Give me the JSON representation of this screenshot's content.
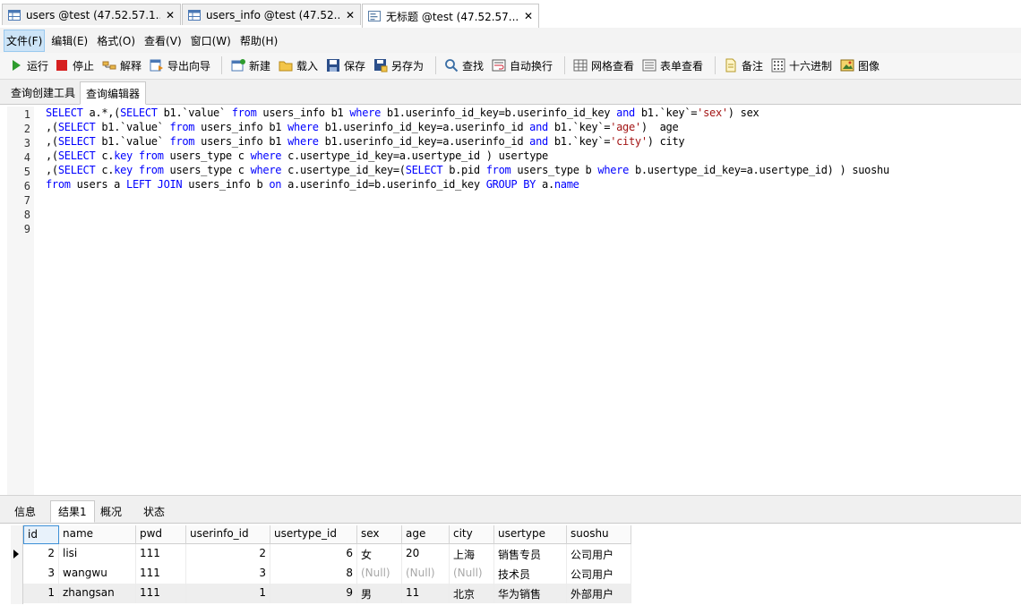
{
  "window_tabs": [
    {
      "label": "users @test (47.52.57.1...",
      "close": "✕"
    },
    {
      "label": "users_info @test (47.52...",
      "close": "✕"
    },
    {
      "label": "无标题 @test (47.52.57...",
      "close": "✕"
    }
  ],
  "menu": [
    "文件(F)",
    "编辑(E)",
    "格式(O)",
    "查看(V)",
    "窗口(W)",
    "帮助(H)"
  ],
  "toolbar": {
    "run": "运行",
    "stop": "停止",
    "explain": "解释",
    "export_wizard": "导出向导",
    "new": "新建",
    "load": "载入",
    "save": "保存",
    "save_as": "另存为",
    "find": "查找",
    "word_wrap": "自动换行",
    "grid_view": "网格查看",
    "form_view": "表单查看",
    "memo": "备注",
    "hex": "十六进制",
    "image": "图像"
  },
  "editor_tabs": [
    "查询创建工具",
    "查询编辑器"
  ],
  "line_numbers": [
    "1",
    "2",
    "3",
    "4",
    "5",
    "6",
    "7",
    "8",
    "9"
  ],
  "sql_lines": [
    [
      [
        "kw",
        "SELECT"
      ],
      [
        "t",
        " a.*,("
      ],
      [
        "kw",
        "SELECT"
      ],
      [
        "t",
        " b1.`value` "
      ],
      [
        "kw",
        "from"
      ],
      [
        "t",
        " users_info b1 "
      ],
      [
        "kw",
        "where"
      ],
      [
        "t",
        " b1.userinfo_id_key=b.userinfo_id_key "
      ],
      [
        "kw",
        "and"
      ],
      [
        "t",
        " b1.`key`="
      ],
      [
        "st",
        "'sex'"
      ],
      [
        "t",
        ") sex"
      ]
    ],
    [
      [
        "t",
        ",("
      ],
      [
        "kw",
        "SELECT"
      ],
      [
        "t",
        " b1.`value` "
      ],
      [
        "kw",
        "from"
      ],
      [
        "t",
        " users_info b1 "
      ],
      [
        "kw",
        "where"
      ],
      [
        "t",
        " b1.userinfo_id_key=a.userinfo_id "
      ],
      [
        "kw",
        "and"
      ],
      [
        "t",
        " b1.`key`="
      ],
      [
        "st",
        "'age'"
      ],
      [
        "t",
        ")  age"
      ]
    ],
    [
      [
        "t",
        ",("
      ],
      [
        "kw",
        "SELECT"
      ],
      [
        "t",
        " b1.`value` "
      ],
      [
        "kw",
        "from"
      ],
      [
        "t",
        " users_info b1 "
      ],
      [
        "kw",
        "where"
      ],
      [
        "t",
        " b1.userinfo_id_key=a.userinfo_id "
      ],
      [
        "kw",
        "and"
      ],
      [
        "t",
        " b1.`key`="
      ],
      [
        "st",
        "'city'"
      ],
      [
        "t",
        ") city"
      ]
    ],
    [
      [
        "t",
        ",("
      ],
      [
        "kw",
        "SELECT"
      ],
      [
        "t",
        " c."
      ],
      [
        "kw",
        "key"
      ],
      [
        "t",
        " "
      ],
      [
        "kw",
        "from"
      ],
      [
        "t",
        " users_type c "
      ],
      [
        "kw",
        "where"
      ],
      [
        "t",
        " c.usertype_id_key=a.usertype_id ) usertype"
      ]
    ],
    [
      [
        "t",
        ",("
      ],
      [
        "kw",
        "SELECT"
      ],
      [
        "t",
        " c."
      ],
      [
        "kw",
        "key"
      ],
      [
        "t",
        " "
      ],
      [
        "kw",
        "from"
      ],
      [
        "t",
        " users_type c "
      ],
      [
        "kw",
        "where"
      ],
      [
        "t",
        " c.usertype_id_key=("
      ],
      [
        "kw",
        "SELECT"
      ],
      [
        "t",
        " b.pid "
      ],
      [
        "kw",
        "from"
      ],
      [
        "t",
        " users_type b "
      ],
      [
        "kw",
        "where"
      ],
      [
        "t",
        " b.usertype_id_key=a.usertype_id) ) suoshu"
      ]
    ],
    [
      [
        "kw",
        "from"
      ],
      [
        "t",
        " users a "
      ],
      [
        "kw",
        "LEFT JOIN"
      ],
      [
        "t",
        " users_info b "
      ],
      [
        "kw",
        "on"
      ],
      [
        "t",
        " a.userinfo_id=b.userinfo_id_key "
      ],
      [
        "kw",
        "GROUP BY"
      ],
      [
        "t",
        " a."
      ],
      [
        "kw",
        "name"
      ]
    ]
  ],
  "result_tabs": [
    "信息",
    "结果1",
    "概况",
    "状态"
  ],
  "columns": [
    "id",
    "name",
    "pwd",
    "userinfo_id",
    "usertype_id",
    "sex",
    "age",
    "city",
    "usertype",
    "suoshu"
  ],
  "rows": [
    [
      "2",
      "lisi",
      "111",
      "2",
      "6",
      "女",
      "20",
      "上海",
      "销售专员",
      "公司用户"
    ],
    [
      "3",
      "wangwu",
      "111",
      "3",
      "8",
      "(Null)",
      "(Null)",
      "(Null)",
      "技术员",
      "公司用户"
    ],
    [
      "1",
      "zhangsan",
      "111",
      "1",
      "9",
      "男",
      "11",
      "北京",
      "华为销售",
      "外部用户"
    ]
  ],
  "colors": {
    "keyword": "#0000ff",
    "string": "#a31515",
    "null_text": "#a8a8a8",
    "selection": "#cce4f7"
  }
}
